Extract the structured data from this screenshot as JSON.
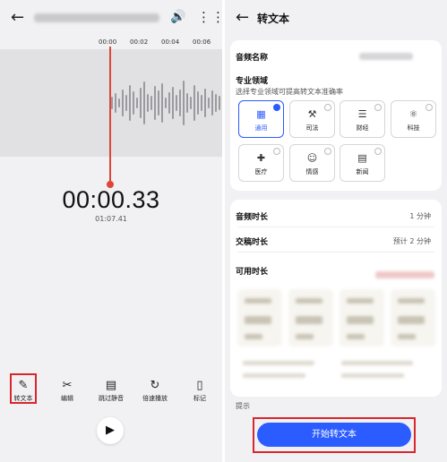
{
  "left": {
    "ruler_ticks": [
      "00:00",
      "00:02",
      "00:04",
      "00:06"
    ],
    "current_time": "00:00.33",
    "total_time": "01:07.41",
    "tools": [
      {
        "label": "转文本",
        "icon": "transcribe-icon"
      },
      {
        "label": "编辑",
        "icon": "edit-icon"
      },
      {
        "label": "跳过静音",
        "icon": "skip-silence-icon"
      },
      {
        "label": "倍速播放",
        "icon": "speed-icon"
      },
      {
        "label": "标记",
        "icon": "bookmark-icon"
      }
    ]
  },
  "right": {
    "title": "转文本",
    "audio_name_label": "音频名称",
    "domain_label": "专业领域",
    "domain_hint": "选择专业领域可提高转文本准确率",
    "domains": [
      {
        "label": "通用",
        "icon": "grid-icon",
        "selected": true
      },
      {
        "label": "司法",
        "icon": "gavel-icon",
        "selected": false
      },
      {
        "label": "财经",
        "icon": "coins-icon",
        "selected": false
      },
      {
        "label": "科技",
        "icon": "atom-icon",
        "selected": false
      },
      {
        "label": "医疗",
        "icon": "medical-kit-icon",
        "selected": false
      },
      {
        "label": "情感",
        "icon": "emotion-icon",
        "selected": false
      },
      {
        "label": "新闻",
        "icon": "news-icon",
        "selected": false
      }
    ],
    "audio_duration_label": "音频时长",
    "audio_duration_value": "1 分钟",
    "transcribe_duration_label": "交稿时长",
    "transcribe_duration_value": "预计 2 分钟",
    "available_label": "可用时长",
    "hint_label": "提示",
    "start_button": "开始转文本"
  },
  "colors": {
    "accent": "#2a5cff",
    "playhead": "#e0453a",
    "highlight": "#d9262c"
  }
}
